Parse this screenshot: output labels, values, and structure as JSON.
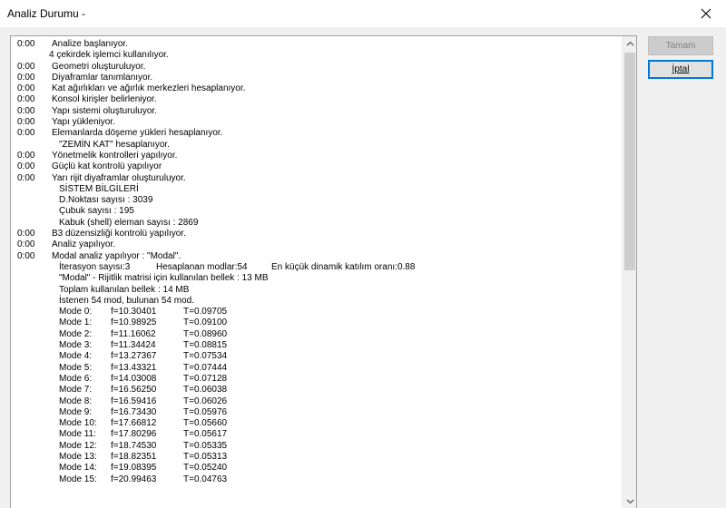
{
  "window": {
    "title": "Analiz Durumu -",
    "close_glyph": "×"
  },
  "buttons": {
    "ok_label": "Tamam",
    "cancel_label": "İptal"
  },
  "log": [
    {
      "time": "0:00",
      "text": "Analize başlanıyor.",
      "indent": 0
    },
    {
      "time": "",
      "text": "4 çekirdek işlemci kullanılıyor.",
      "indent": 2
    },
    {
      "time": "0:00",
      "text": "Geometri oluşturuluyor.",
      "indent": 0
    },
    {
      "time": "0:00",
      "text": "Diyaframlar tanımlanıyor.",
      "indent": 0
    },
    {
      "time": "0:00",
      "text": "Kat ağırlıkları ve ağırlık merkezleri hesaplanıyor.",
      "indent": 0
    },
    {
      "time": "0:00",
      "text": "Konsol kirişler belirleniyor.",
      "indent": 0
    },
    {
      "time": "0:00",
      "text": "Yapı sistemi oluşturuluyor.",
      "indent": 0
    },
    {
      "time": "0:00",
      "text": "Yapı yükleniyor.",
      "indent": 0
    },
    {
      "time": "0:00",
      "text": "Elemanlarda döşeme yükleri hesaplanıyor.",
      "indent": 0
    },
    {
      "time": "",
      "text": "\"ZEMİN KAT\" hesaplanıyor.",
      "indent": 1
    },
    {
      "time": "0:00",
      "text": "Yönetmelik kontrolleri yapılıyor.",
      "indent": 0
    },
    {
      "time": "0:00",
      "text": "Güçlü kat kontrolü yapılıyor",
      "indent": 0
    },
    {
      "time": "0:00",
      "text": "Yarı rijit diyaframlar oluşturuluyor.",
      "indent": 0
    },
    {
      "time": "",
      "text": "SİSTEM BİLGİLERİ",
      "indent": 1
    },
    {
      "time": "",
      "text": "D.Noktası sayısı : 3039",
      "indent": 1
    },
    {
      "time": "",
      "text": "Çubuk sayısı : 195",
      "indent": 1
    },
    {
      "time": "",
      "text": "Kabuk (shell) eleman sayısı : 2869",
      "indent": 1
    },
    {
      "time": "0:00",
      "text": "B3 düzensizliği kontrolü yapılıyor.",
      "indent": 0
    },
    {
      "time": "0:00",
      "text": "Analiz yapılıyor.",
      "indent": 0
    },
    {
      "time": "0:00",
      "text": "Modal analiz yapılıyor : \"Modal\".",
      "indent": 0
    }
  ],
  "iteration_row": {
    "iter": "İterasyon sayısı:3",
    "modes": "Hesaplanan modlar:54",
    "ratio": "En küçük dinamik katılım oranı:0.88"
  },
  "log2": [
    {
      "text": "\"Modal\" - Rijitlik matrisi için kullanılan bellek : 13 MB"
    },
    {
      "text": "Toplam kullanılan bellek : 14 MB"
    },
    {
      "text": "İstenen 54 mod, bulunan 54 mod."
    }
  ],
  "modes": [
    {
      "mode": "Mode 0:",
      "f": "f=10.30401",
      "T": "T=0.09705"
    },
    {
      "mode": "Mode 1:",
      "f": "f=10.98925",
      "T": "T=0.09100"
    },
    {
      "mode": "Mode 2:",
      "f": "f=11.16062",
      "T": "T=0.08960"
    },
    {
      "mode": "Mode 3:",
      "f": "f=11.34424",
      "T": "T=0.08815"
    },
    {
      "mode": "Mode 4:",
      "f": "f=13.27367",
      "T": "T=0.07534"
    },
    {
      "mode": "Mode 5:",
      "f": "f=13.43321",
      "T": "T=0.07444"
    },
    {
      "mode": "Mode 6:",
      "f": "f=14.03008",
      "T": "T=0.07128"
    },
    {
      "mode": "Mode 7:",
      "f": "f=16.56250",
      "T": "T=0.06038"
    },
    {
      "mode": "Mode 8:",
      "f": "f=16.59416",
      "T": "T=0.06026"
    },
    {
      "mode": "Mode 9:",
      "f": "f=16.73430",
      "T": "T=0.05976"
    },
    {
      "mode": "Mode 10:",
      "f": "f=17.66812",
      "T": "T=0.05660"
    },
    {
      "mode": "Mode 11:",
      "f": "f=17.80296",
      "T": "T=0.05617"
    },
    {
      "mode": "Mode 12:",
      "f": "f=18.74530",
      "T": "T=0.05335"
    },
    {
      "mode": "Mode 13:",
      "f": "f=18.82351",
      "T": "T=0.05313"
    },
    {
      "mode": "Mode 14:",
      "f": "f=19.08395",
      "T": "T=0.05240"
    },
    {
      "mode": "Mode 15:",
      "f": "f=20.99463",
      "T": "T=0.04763"
    }
  ],
  "modal_time": "0:00"
}
